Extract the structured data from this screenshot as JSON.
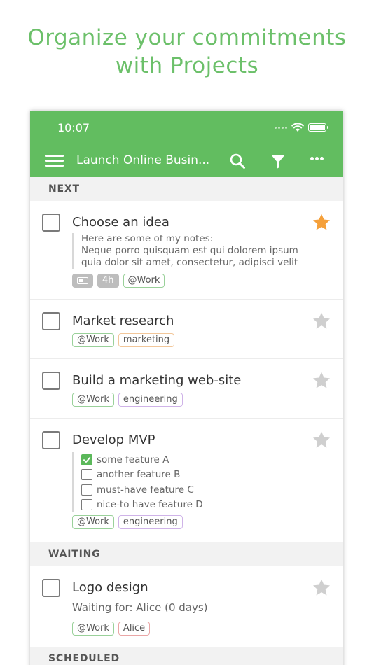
{
  "promo": {
    "line1": "Organize your commitments",
    "line2": "with Projects"
  },
  "status": {
    "time": "10:07"
  },
  "appbar": {
    "title": "Launch Online Busin...",
    "icons": [
      "menu-icon",
      "search-icon",
      "filter-icon",
      "more-icon"
    ]
  },
  "colors": {
    "brand": "#62bd60",
    "star_active": "#f5a03a",
    "star_inactive": "#cfcfcf",
    "check_done": "#5bb85a"
  },
  "sections": {
    "next": "NEXT",
    "waiting": "WAITING",
    "scheduled": "SCHEDULED"
  },
  "tasks": [
    {
      "title": "Choose an idea",
      "starred": true,
      "note": [
        "Here are some of my notes:",
        "Neque porro quisquam est qui dolorem ipsum",
        "quia dolor sit amet, consectetur, adipisci velit"
      ],
      "duration": "4h",
      "tags": [
        "@Work"
      ]
    },
    {
      "title": "Market research",
      "starred": false,
      "tags": [
        "@Work",
        "marketing"
      ]
    },
    {
      "title": "Build a marketing web-site",
      "starred": false,
      "tags": [
        "@Work",
        "engineering"
      ]
    },
    {
      "title": "Develop MVP",
      "starred": false,
      "subtasks": [
        {
          "label": "some feature A",
          "done": true
        },
        {
          "label": "another feature B",
          "done": false
        },
        {
          "label": "must-have feature C",
          "done": false
        },
        {
          "label": "nice-to have feature D",
          "done": false
        }
      ],
      "tags": [
        "@Work",
        "engineering"
      ]
    },
    {
      "title": "Logo design",
      "starred": false,
      "waiting_for": "Waiting for: Alice (0 days)",
      "tags": [
        "@Work",
        "Alice"
      ]
    }
  ]
}
